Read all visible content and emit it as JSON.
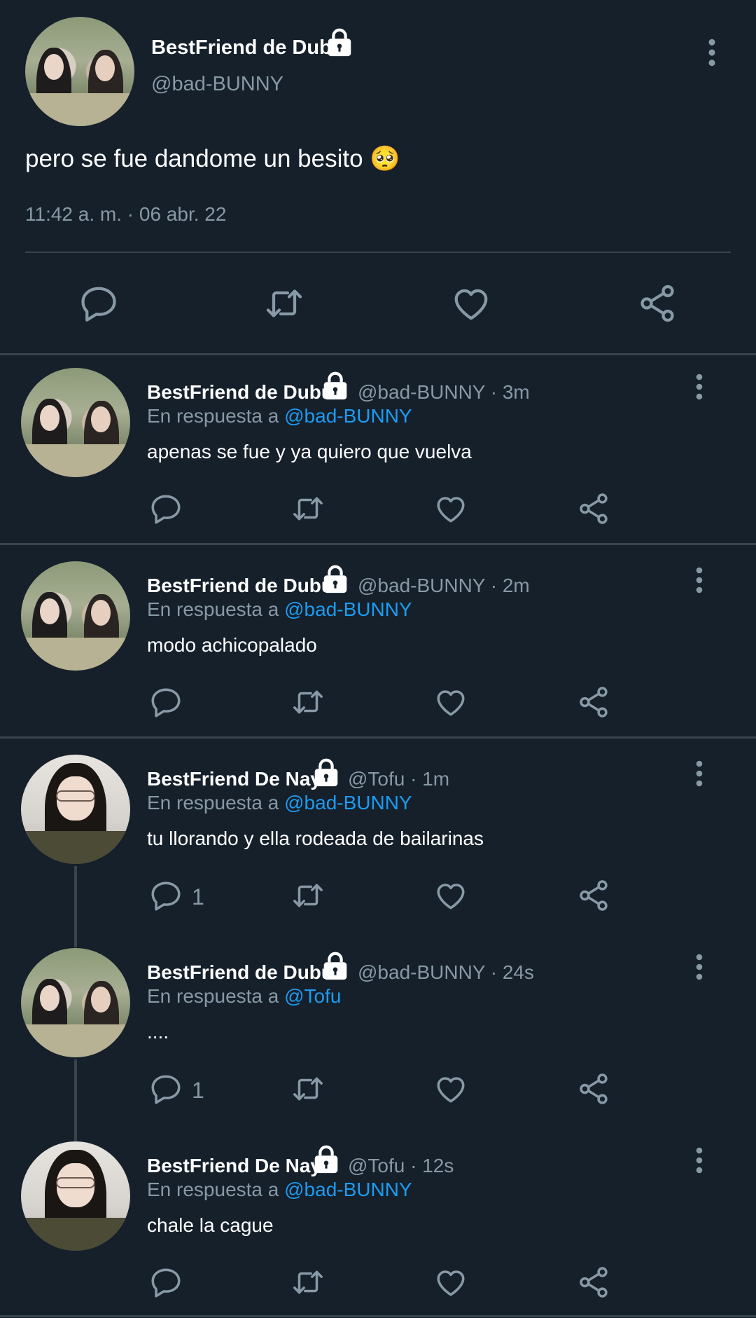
{
  "main_tweet": {
    "display_name": "BestFriend de Dubu",
    "handle": "@bad-BUNNY",
    "text": "pero se fue dandome un besito 🥺",
    "timestamp": "11:42 a. m. · 06 abr. 22"
  },
  "replies": [
    {
      "display_name": "BestFriend de Dubu",
      "meta": "@bad-BUNNY · 3m",
      "reply_prefix": "En respuesta a ",
      "reply_to": "@bad-BUNNY",
      "text": "apenas se fue y ya quiero que vuelva",
      "reply_count": ""
    },
    {
      "display_name": "BestFriend de Dubu",
      "meta": "@bad-BUNNY · 2m",
      "reply_prefix": "En respuesta a ",
      "reply_to": "@bad-BUNNY",
      "text": "modo achicopalado",
      "reply_count": ""
    },
    {
      "display_name": "BestFriend De Nay",
      "meta": "@Tofu · 1m",
      "reply_prefix": "En respuesta a ",
      "reply_to": "@bad-BUNNY",
      "text": "tu llorando y ella rodeada de bailarinas",
      "reply_count": "1"
    },
    {
      "display_name": "BestFriend de Dubu",
      "meta": "@bad-BUNNY · 24s",
      "reply_prefix": "En respuesta a ",
      "reply_to": "@Tofu",
      "text": "....",
      "reply_count": "1"
    },
    {
      "display_name": "BestFriend De Nay",
      "meta": "@Tofu · 12s",
      "reply_prefix": "En respuesta a ",
      "reply_to": "@bad-BUNNY",
      "text": "chale la cague",
      "reply_count": ""
    }
  ],
  "icons": {
    "lock": "lock-icon",
    "reply": "reply-icon",
    "retweet": "retweet-icon",
    "like": "like-icon",
    "share": "share-icon",
    "more": "more-vertical-icon"
  },
  "colors": {
    "background": "#15202b",
    "muted": "#8899a6",
    "link": "#1d9bf0",
    "divider": "#38444d"
  }
}
